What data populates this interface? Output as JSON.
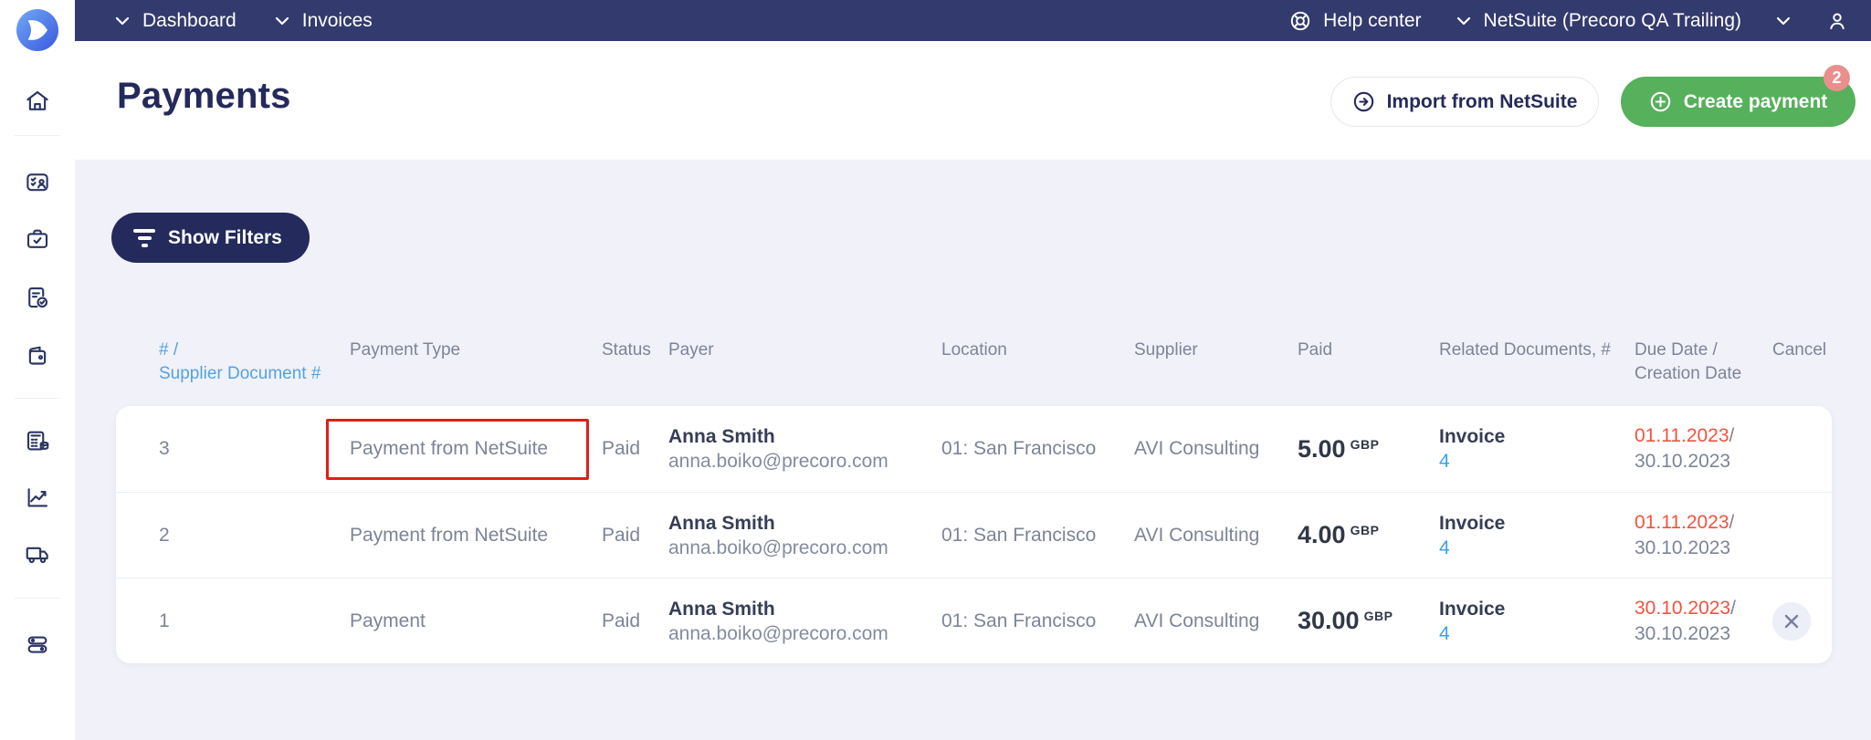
{
  "app": {
    "logo_icon": "precoro-logo"
  },
  "topbar": {
    "breadcrumbs": [
      {
        "label": "Dashboard"
      },
      {
        "label": "Invoices"
      }
    ],
    "help_center": {
      "icon": "lifebuoy-icon",
      "label": "Help center"
    },
    "workspace": {
      "label": "NetSuite (Precoro QA Trailing)"
    },
    "user_icon": "user-icon"
  },
  "sidebar": {
    "icons": [
      "home-icon",
      "approvals-icon",
      "briefcase-check-icon",
      "document-check-icon",
      "wallet-icon",
      "budget-calculator-icon",
      "reports-chart-icon",
      "truck-icon",
      "settings-toggles-icon"
    ]
  },
  "header": {
    "title": "Payments",
    "import_button_label": "Import from NetSuite",
    "create_button_label": "Create payment",
    "create_badge_count": "2"
  },
  "filters": {
    "toggle_label": "Show Filters"
  },
  "table": {
    "headers": {
      "number_line1": "# /",
      "number_line2": "Supplier Document #",
      "payment_type": "Payment Type",
      "status": "Status",
      "payer": "Payer",
      "location": "Location",
      "supplier": "Supplier",
      "paid": "Paid",
      "related": "Related Documents, #",
      "due_line1": "Due Date /",
      "due_line2": "Creation Date",
      "cancel": "Cancel"
    },
    "date_separator": "/",
    "rows": [
      {
        "number": "3",
        "payment_type": "Payment from NetSuite",
        "status": "Paid",
        "payer_name": "Anna Smith",
        "payer_email": "anna.boiko@precoro.com",
        "location": "01: San Francisco",
        "supplier": "AVI Consulting",
        "paid_amount": "5.00",
        "paid_currency": "GBP",
        "related_type": "Invoice",
        "related_number": "4",
        "due_date": "01.11.2023",
        "creation_date": "30.10.2023"
      },
      {
        "number": "2",
        "payment_type": "Payment from NetSuite",
        "status": "Paid",
        "payer_name": "Anna Smith",
        "payer_email": "anna.boiko@precoro.com",
        "location": "01: San Francisco",
        "supplier": "AVI Consulting",
        "paid_amount": "4.00",
        "paid_currency": "GBP",
        "related_type": "Invoice",
        "related_number": "4",
        "due_date": "01.11.2023",
        "creation_date": "30.10.2023"
      },
      {
        "number": "1",
        "payment_type": "Payment",
        "status": "Paid",
        "payer_name": "Anna Smith",
        "payer_email": "anna.boiko@precoro.com",
        "location": "01: San Francisco",
        "supplier": "AVI Consulting",
        "paid_amount": "30.00",
        "paid_currency": "GBP",
        "related_type": "Invoice",
        "related_number": "4",
        "due_date": "30.10.2023",
        "creation_date": "30.10.2023"
      }
    ]
  },
  "annotation": {
    "type": "highlight-box",
    "target": "row-3-payment-type",
    "color": "#e41c17"
  },
  "colors": {
    "navbar": "#333a6e",
    "primary_dark": "#252a5b",
    "green": "#57b05c",
    "badge_pink": "#eb8e8e",
    "link_blue": "#3ba0ea",
    "date_red": "#f4523f",
    "text_gray": "#7d8498",
    "text_dark": "#363d55",
    "page_bg": "#f0f1f9"
  }
}
